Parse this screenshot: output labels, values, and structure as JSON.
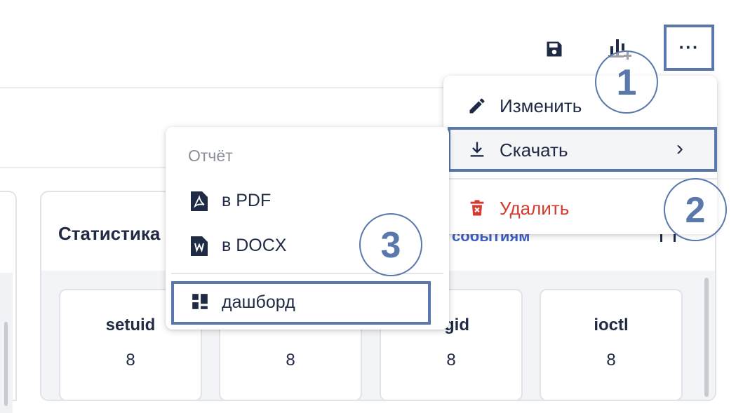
{
  "toolbar": {
    "save_icon": "floppy-disk-icon",
    "add_chart_icon": "bar-chart-add-icon",
    "more_label": "···"
  },
  "context_menu": {
    "items": [
      {
        "label": "Изменить",
        "icon": "pencil-icon"
      },
      {
        "label": "Скачать",
        "icon": "download-icon",
        "chevron": "›"
      },
      {
        "label": "Удалить",
        "icon": "trash-icon",
        "color": "#d43a2f"
      }
    ]
  },
  "download_submenu": {
    "header": "Отчёт",
    "items": [
      {
        "label": "в PDF",
        "icon": "pdf-file-icon"
      },
      {
        "label": "в DOCX",
        "icon": "word-file-icon"
      },
      {
        "label": "дашборд",
        "icon": "dashboard-icon"
      }
    ]
  },
  "panel": {
    "title": "Статистика",
    "link": "событиям",
    "cards": [
      {
        "title": "setuid",
        "value": "8"
      },
      {
        "title": "",
        "value": "8"
      },
      {
        "title": "gid",
        "value": "8"
      },
      {
        "title": "ioctl",
        "value": "8"
      }
    ]
  },
  "annotations": [
    "1",
    "2",
    "3"
  ],
  "colors": {
    "accent_outline": "#5a78ab",
    "danger": "#d43a2f",
    "text": "#1f2a44",
    "link": "#3f5fc9"
  }
}
